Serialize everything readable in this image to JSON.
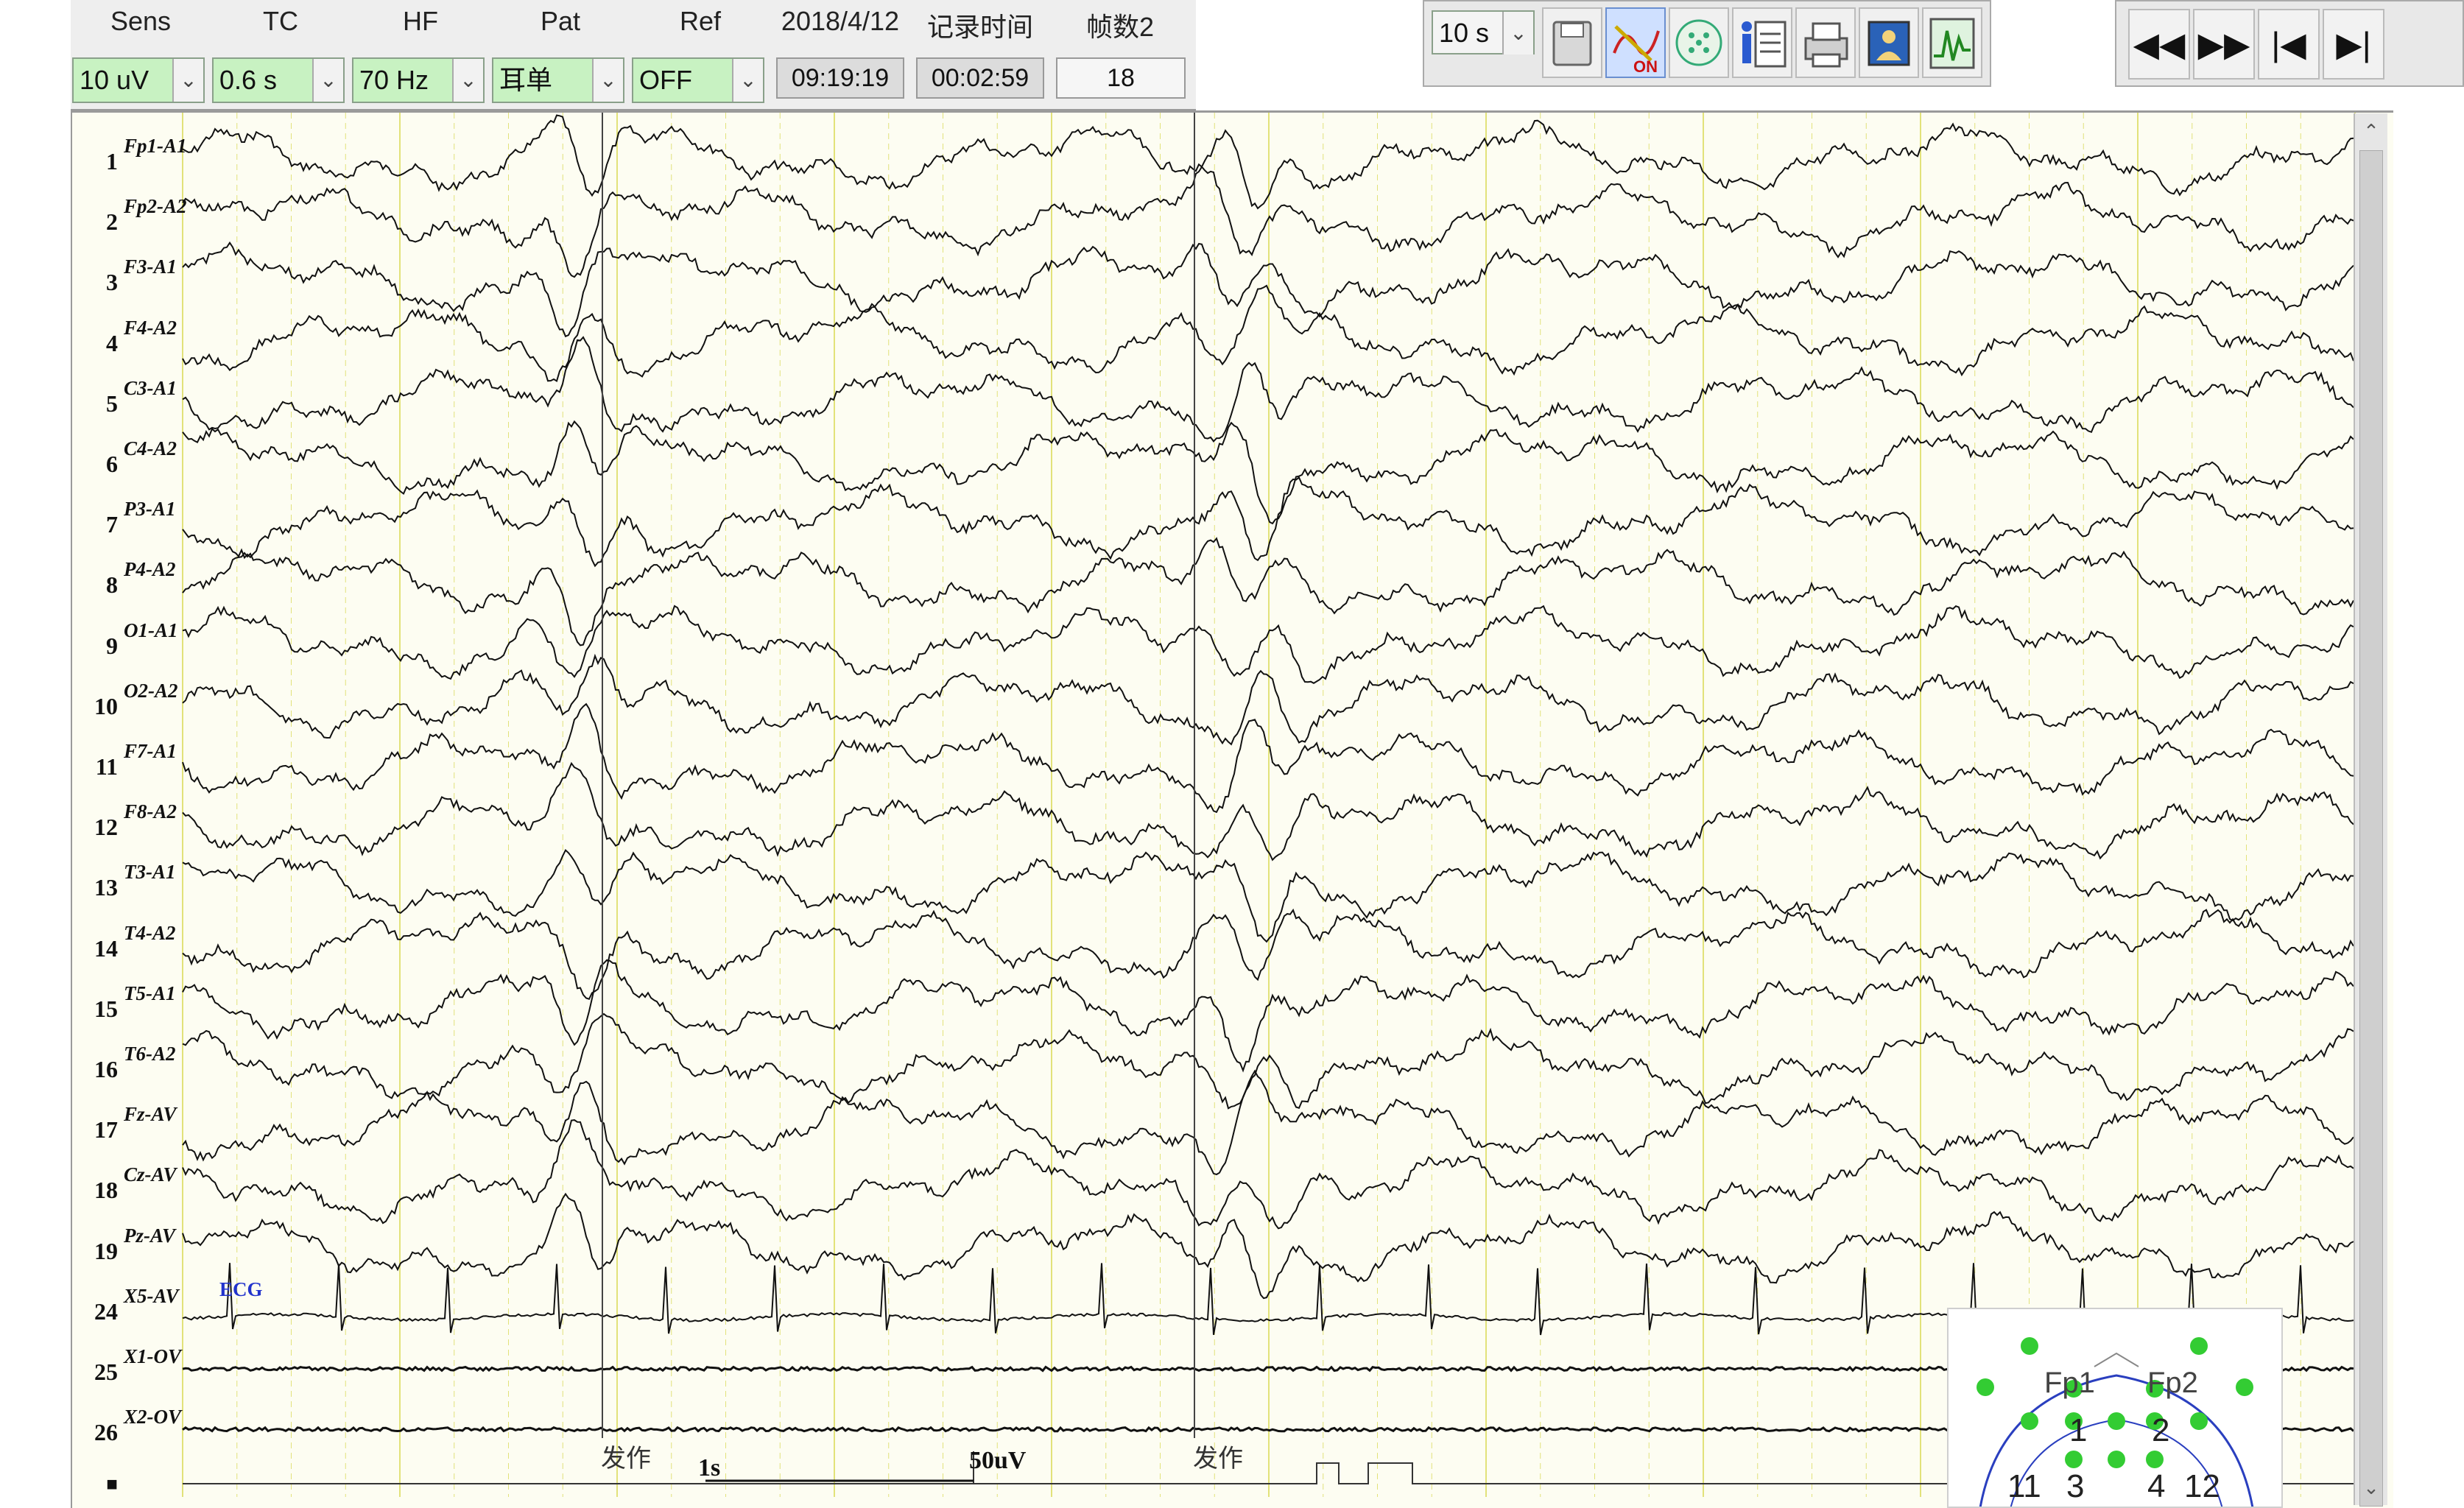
{
  "toolbar": {
    "headers": {
      "sens": "Sens",
      "tc": "TC",
      "hf": "HF",
      "pat": "Pat",
      "ref": "Ref",
      "date": "2018/4/12",
      "rec_time_label": "记录时间",
      "frames_label": "帧数2"
    },
    "sens_value": "10 uV",
    "tc_value": "0.6 s",
    "hf_value": "70 Hz",
    "pat_value": "耳单",
    "ref_value": "OFF",
    "clock": "09:19:19",
    "record_time": "00:02:59",
    "frame_count": "18",
    "timebase_value": "10 s",
    "icons": [
      "save-icon",
      "eeg-on-icon",
      "montage-grid-icon",
      "patient-info-icon",
      "print-icon",
      "image-icon",
      "waveform-icon"
    ],
    "icon_on_text": "ON",
    "nav": {
      "rewind": "◀◀",
      "forward": "▶▶",
      "first": "|◀",
      "last": "▶|"
    }
  },
  "eeg": {
    "channels": [
      {
        "num": "1",
        "label": "Fp1-A1"
      },
      {
        "num": "2",
        "label": "Fp2-A2"
      },
      {
        "num": "3",
        "label": "F3-A1"
      },
      {
        "num": "4",
        "label": "F4-A2"
      },
      {
        "num": "5",
        "label": "C3-A1"
      },
      {
        "num": "6",
        "label": "C4-A2"
      },
      {
        "num": "7",
        "label": "P3-A1"
      },
      {
        "num": "8",
        "label": "P4-A2"
      },
      {
        "num": "9",
        "label": "O1-A1"
      },
      {
        "num": "10",
        "label": "O2-A2"
      },
      {
        "num": "11",
        "label": "F7-A1"
      },
      {
        "num": "12",
        "label": "F8-A2"
      },
      {
        "num": "13",
        "label": "T3-A1"
      },
      {
        "num": "14",
        "label": "T4-A2"
      },
      {
        "num": "15",
        "label": "T5-A1"
      },
      {
        "num": "16",
        "label": "T6-A2"
      },
      {
        "num": "17",
        "label": "Fz-AV"
      },
      {
        "num": "18",
        "label": "Cz-AV"
      },
      {
        "num": "19",
        "label": "Pz-AV"
      },
      {
        "num": "24",
        "label": "X5-AV"
      },
      {
        "num": "25",
        "label": "X1-OV"
      },
      {
        "num": "26",
        "label": "X2-OV"
      }
    ],
    "ecg_tag": "ECG",
    "event_row_marker": "■",
    "annotations": [
      "发作",
      "发作"
    ],
    "time_scale": "1s",
    "amp_scale": "50uV"
  },
  "head_map": {
    "labels": [
      "Fp1",
      "Fp2"
    ],
    "numbers": [
      "1",
      "2",
      "11",
      "3",
      "4",
      "12"
    ],
    "electrode_color": "#33cc33",
    "outline_color": "#2a3fbf"
  },
  "colors": {
    "combo_bg": "#c8f2c2",
    "trace_bg": "#fdfdf2",
    "grid_line": "#e2e27a",
    "ecg_tag": "#2233cc"
  }
}
